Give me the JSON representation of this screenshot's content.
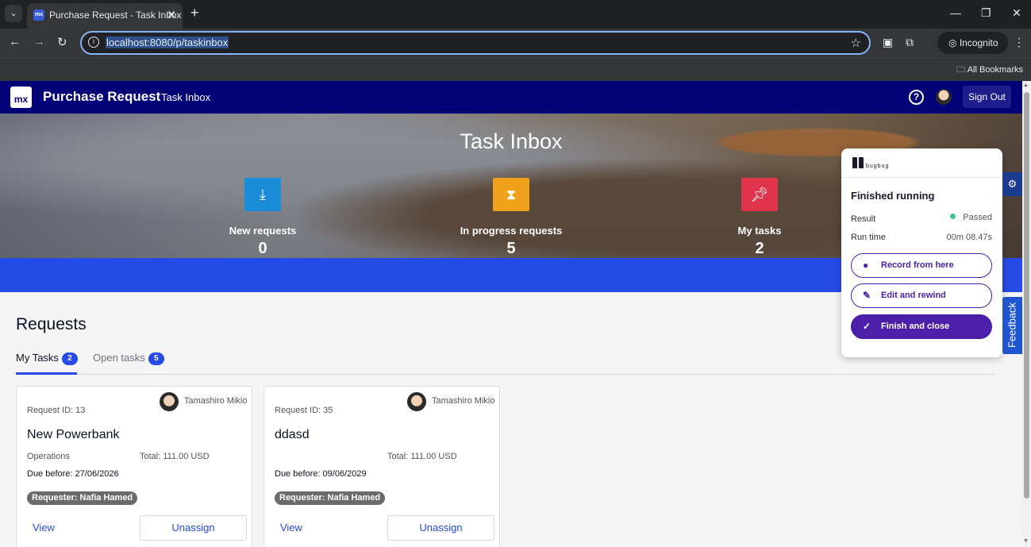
{
  "browser": {
    "tab_title": "Purchase Request - Task Inbox",
    "favicon_text": "mx",
    "url": "localhost:8080/p/taskinbox",
    "incognito_label": "Incognito",
    "bookmarks_label": "All Bookmarks"
  },
  "header": {
    "logo_text": "mx",
    "app_name": "Purchase Request",
    "page_name": "Task Inbox",
    "help_icon": "?",
    "signout_label": "Sign Out"
  },
  "hero": {
    "title": "Task Inbox",
    "stats": [
      {
        "label": "New requests",
        "value": "0",
        "icon": "download-icon",
        "color": "#1a8cd8"
      },
      {
        "label": "In progress requests",
        "value": "5",
        "icon": "hourglass-icon",
        "color": "#f0a21b"
      },
      {
        "label": "My tasks",
        "value": "2",
        "icon": "pin-icon",
        "color": "#e0344d"
      }
    ]
  },
  "requests": {
    "title": "Requests",
    "tabs": [
      {
        "label": "My Tasks",
        "count": "2"
      },
      {
        "label": "Open tasks",
        "count": "5"
      }
    ],
    "cards": [
      {
        "request_id": "Request ID: 13",
        "owner": "Tamashiro Mikio",
        "name": "New Powerbank",
        "department": "Operations",
        "total": "Total: 111.00 USD",
        "due": "Due before: 27/06/2026",
        "requester": "Requester: Nafia Hamed",
        "view_label": "View",
        "unassign_label": "Unassign"
      },
      {
        "request_id": "Request ID: 35",
        "owner": "Tamashiro Mikio",
        "name": "ddasd",
        "department": "",
        "total": "Total: 111.00 USD",
        "due": "Due before: 09/06/2029",
        "requester": "Requester: Nafia Hamed",
        "view_label": "View",
        "unassign_label": "Unassign"
      }
    ]
  },
  "bugbug": {
    "logo_text": "bugbug",
    "status": "Finished running",
    "result_label": "Result",
    "result_value": "Passed",
    "runtime_label": "Run time",
    "runtime_value": "00m 08.47s",
    "record_label": "Record from here",
    "edit_label": "Edit and rewind",
    "finish_label": "Finish and close",
    "feedback_label": "Feedback"
  },
  "colors": {
    "header_bg": "#020276",
    "accent_blue": "#264ae5",
    "bugbug_purple": "#4b1fa8",
    "passed_green": "#3ec28f"
  }
}
